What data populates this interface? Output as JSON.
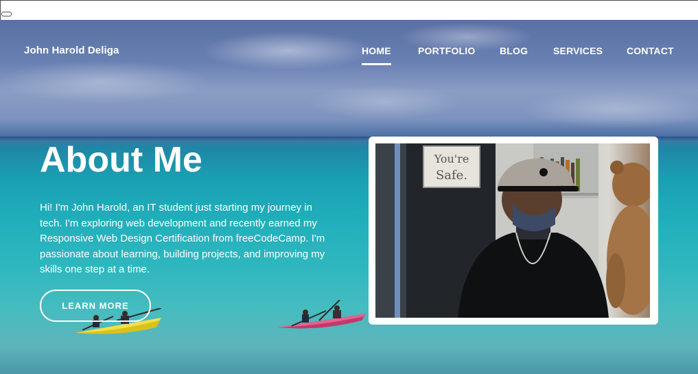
{
  "brand": "John Harold Deliga",
  "nav": {
    "items": [
      "HOME",
      "PORTFOLIO",
      "BLOG",
      "SERVICES",
      "CONTACT"
    ],
    "active": "HOME"
  },
  "hero": {
    "title": "About Me",
    "intro": "Hi! I'm John Harold, an IT student just starting my journey in tech. I'm exploring web development and recently earned my Responsive Web Design Certification from freeCodeCamp. I'm passionate about learning, building projects, and improving my skills one step at a time.",
    "cta_label": "LEARN MORE"
  },
  "photo": {
    "sign_text": "You're Safe."
  },
  "colors": {
    "text": "#ffffff",
    "frame": "#ffffff"
  }
}
